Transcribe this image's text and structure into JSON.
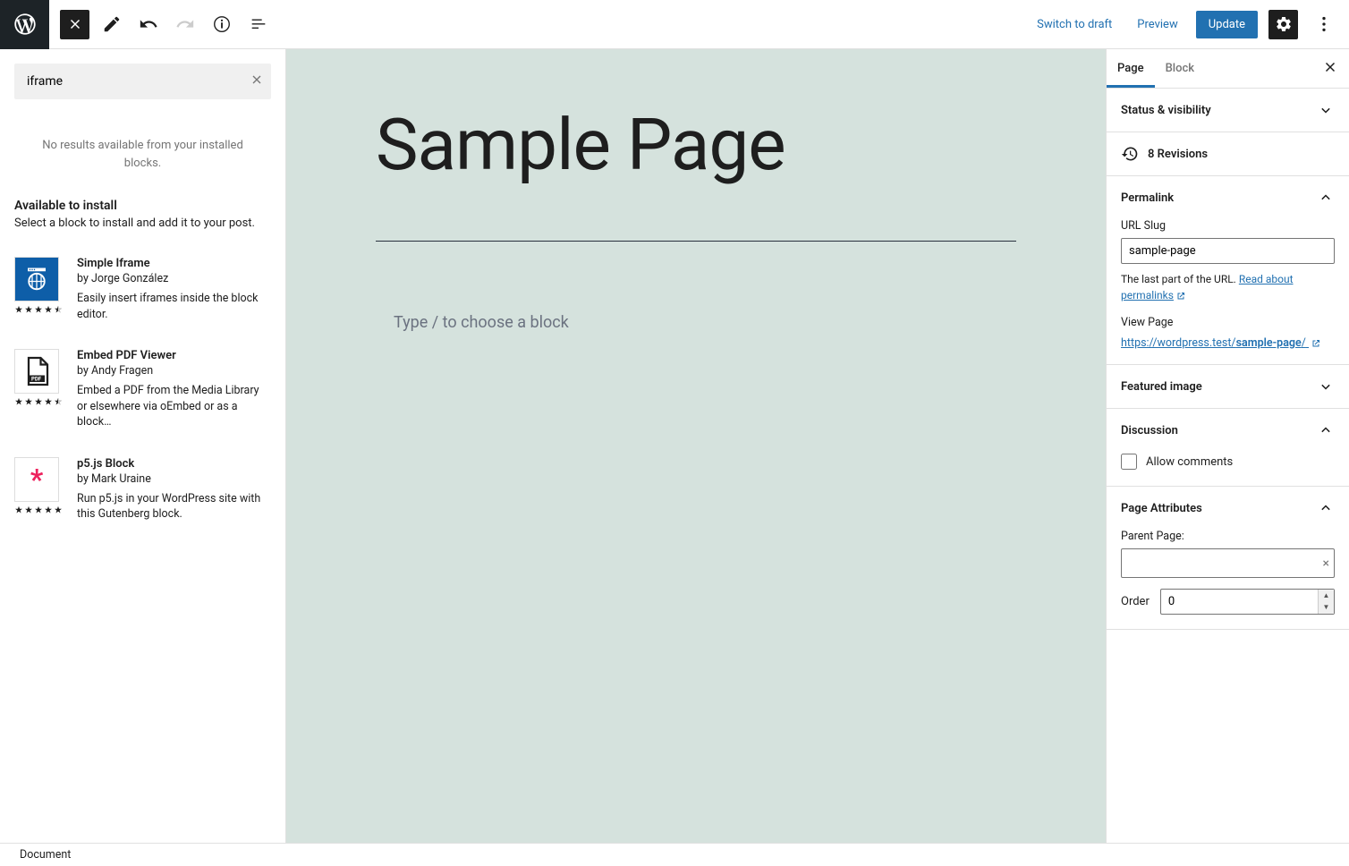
{
  "toolbar": {
    "switch_draft": "Switch to draft",
    "preview": "Preview",
    "update": "Update"
  },
  "inserter": {
    "search_value": "iframe",
    "no_results": "No results available from your installed blocks.",
    "available_heading": "Available to install",
    "available_sub": "Select a block to install and add it to your post.",
    "plugins": [
      {
        "title": "Simple Iframe",
        "author": "by Jorge González",
        "desc": "Easily insert iframes inside the block editor.",
        "rating": 4.5,
        "icon": "iframe"
      },
      {
        "title": "Embed PDF Viewer",
        "author": "by Andy Fragen",
        "desc": "Embed a PDF from the Media Library or elsewhere via oEmbed or as a block…",
        "rating": 4.5,
        "icon": "pdf"
      },
      {
        "title": "p5.js Block",
        "author": "by Mark Uraine",
        "desc": "Run p5.js in your WordPress site with this Gutenberg block.",
        "rating": 5,
        "icon": "p5"
      }
    ]
  },
  "canvas": {
    "title": "Sample Page",
    "placeholder": "Type / to choose a block"
  },
  "settings": {
    "tabs": {
      "page": "Page",
      "block": "Block"
    },
    "status": "Status & visibility",
    "revisions": "8 Revisions",
    "permalink": {
      "title": "Permalink",
      "url_slug_label": "URL Slug",
      "url_slug_value": "sample-page",
      "helper": "The last part of the URL.",
      "read_about": "Read about permalinks",
      "view_page": "View Page",
      "url_prefix": "https://wordpress.test/",
      "url_bold": "sample-page",
      "url_suffix": "/"
    },
    "featured_image": "Featured image",
    "discussion": {
      "title": "Discussion",
      "allow_comments": "Allow comments"
    },
    "page_attrs": {
      "title": "Page Attributes",
      "parent_label": "Parent Page:",
      "order_label": "Order",
      "order_value": "0"
    }
  },
  "breadcrumb": "Document"
}
